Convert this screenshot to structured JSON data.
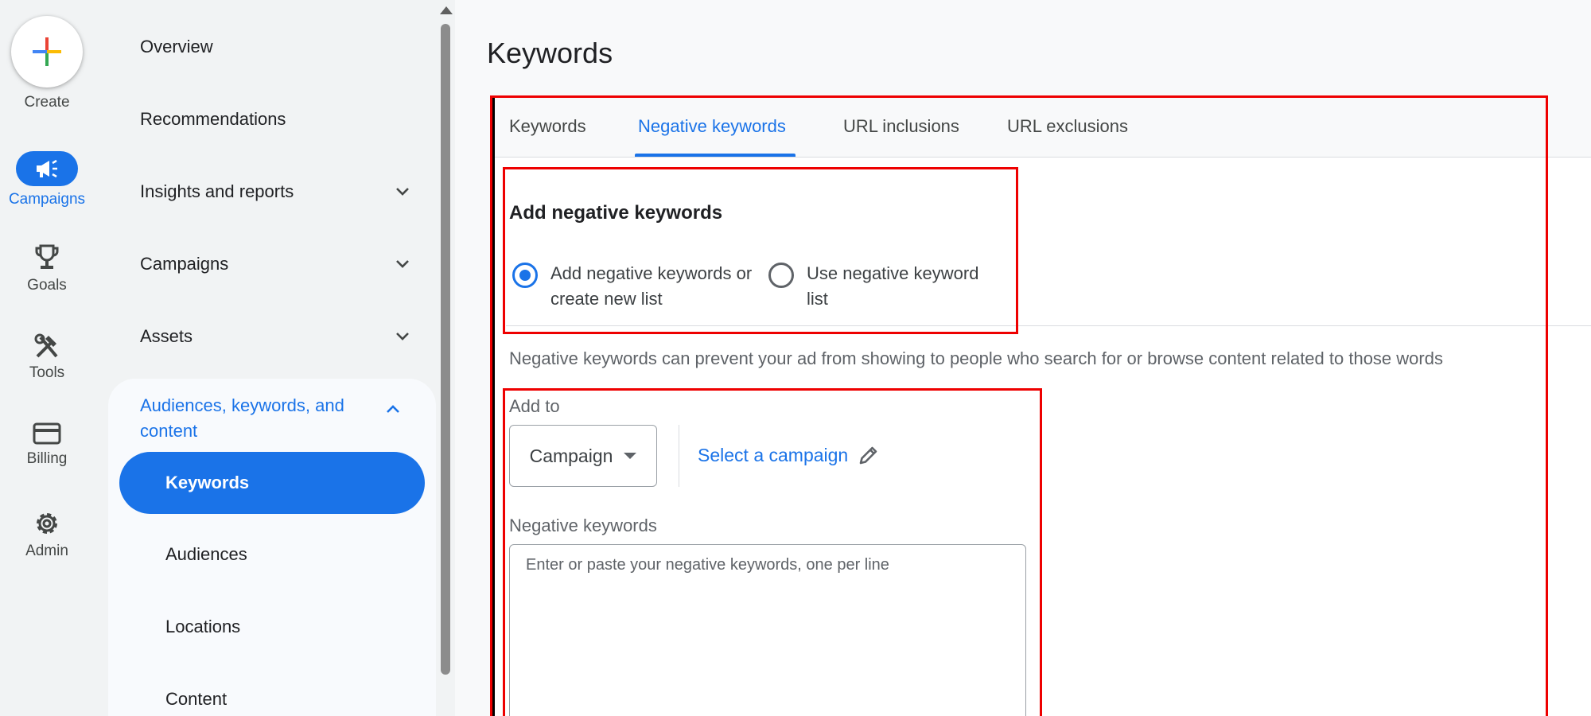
{
  "rail": {
    "create_label": "Create",
    "items": [
      {
        "label": "Campaigns",
        "icon": "megaphone-icon",
        "active": true
      },
      {
        "label": "Goals",
        "icon": "trophy-icon"
      },
      {
        "label": "Tools",
        "icon": "tools-icon"
      },
      {
        "label": "Billing",
        "icon": "credit-card-icon"
      },
      {
        "label": "Admin",
        "icon": "gear-icon"
      }
    ]
  },
  "nav": {
    "items": [
      {
        "label": "Overview"
      },
      {
        "label": "Recommendations"
      },
      {
        "label": "Insights and reports",
        "expandable": true
      },
      {
        "label": "Campaigns",
        "expandable": true
      },
      {
        "label": "Assets",
        "expandable": true
      }
    ],
    "section": {
      "label": "Audiences, keywords, and content",
      "items": [
        {
          "label": "Keywords",
          "active": true
        },
        {
          "label": "Audiences"
        },
        {
          "label": "Locations"
        },
        {
          "label": "Content"
        }
      ]
    }
  },
  "main": {
    "title": "Keywords",
    "tabs": [
      {
        "label": "Keywords"
      },
      {
        "label": "Negative keywords",
        "active": true
      },
      {
        "label": "URL inclusions"
      },
      {
        "label": "URL exclusions"
      }
    ],
    "section_title": "Add negative keywords",
    "radio_options": [
      {
        "label": "Add negative keywords or create new list",
        "selected": true
      },
      {
        "label": "Use negative keyword list",
        "selected": false
      }
    ],
    "helper_text": "Negative keywords can prevent your ad from showing to people who search for or browse content related to those words",
    "add_to_label": "Add to",
    "add_to_value": "Campaign",
    "select_campaign_link": "Select a campaign",
    "negative_keywords_label": "Negative keywords",
    "negative_keywords_placeholder": "Enter or paste your negative keywords, one per line",
    "negative_keywords_value": ""
  },
  "colors": {
    "accent": "#1a73e8",
    "highlight_box": "#ee0000"
  }
}
